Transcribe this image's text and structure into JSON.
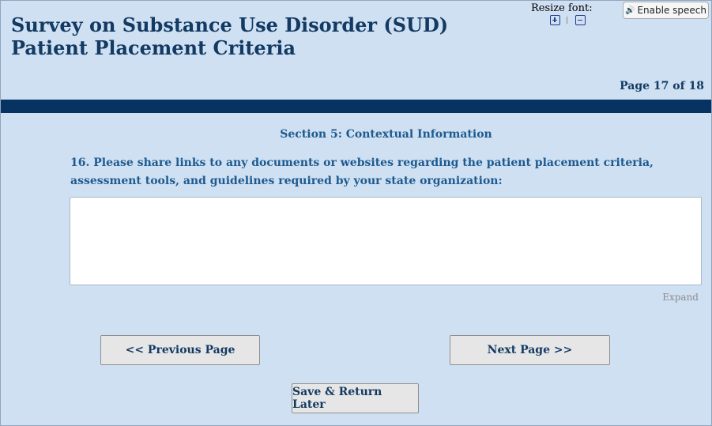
{
  "header": {
    "title": "Survey on Substance Use Disorder (SUD) Patient Placement Criteria",
    "resize_label": "Resize font:",
    "enable_speech_label": "Enable speech",
    "page_indicator": "Page 17 of 18"
  },
  "icons": {
    "increase_font": "plus-box-icon",
    "decrease_font": "minus-box-icon",
    "speech": "speaker-icon"
  },
  "colors": {
    "background": "#cfe0f2",
    "title_text": "#133a63",
    "section_text": "#1d5a90",
    "divider_bar": "#063362",
    "button_bg": "#e6e6e6"
  },
  "section": {
    "heading": "Section 5: Contextual Information"
  },
  "question": {
    "text": "16. Please share links to any documents or websites regarding the patient placement criteria, assessment tools, and guidelines required by your state organization:",
    "answer_value": "",
    "expand_label": "Expand"
  },
  "navigation": {
    "previous_label": "<< Previous Page",
    "next_label": "Next Page >>",
    "save_label": "Save & Return Later"
  }
}
